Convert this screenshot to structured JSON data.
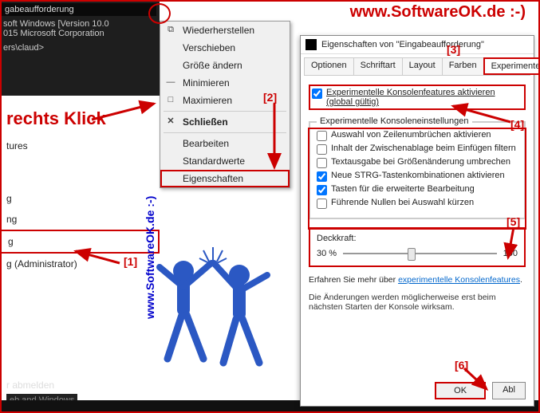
{
  "watermark_url": "www.SoftwareOK.de :-)",
  "annotation_rechts": "rechts Klick",
  "vertical_url": "www.SoftwareOK.de :-)",
  "console": {
    "title": "gabeaufforderung",
    "line1": "soft Windows [Version 10.0",
    "line2": "015 Microsoft Corporation",
    "prompt": "ers\\claud>"
  },
  "start_items": {
    "i0": "tures",
    "i1": "g",
    "i2": "ng",
    "i3": "g",
    "i4": "g (Administrator)",
    "logoff": "r abmelden",
    "bottom": "eb and Windows"
  },
  "ctx": {
    "restore": "Wiederherstellen",
    "move": "Verschieben",
    "size": "Größe ändern",
    "min": "Minimieren",
    "max": "Maximieren",
    "close": "Schließen",
    "edit": "Bearbeiten",
    "defaults": "Standardwerte",
    "props": "Eigenschaften"
  },
  "dialog": {
    "title": "Eigenschaften von \"Eingabeaufforderung\"",
    "tabs": {
      "options": "Optionen",
      "font": "Schriftart",
      "layout": "Layout",
      "colors": "Farben",
      "exp": "Experimentell"
    },
    "enable_exp": "Experimentelle Konsolenfeatures aktivieren (global gültig)",
    "group_label": "Experimentelle Konsoleneinstellungen",
    "opt1": "Auswahl von Zeilenumbrüchen aktivieren",
    "opt2": "Inhalt der Zwischenablage beim Einfügen filtern",
    "opt3": "Textausgabe bei Größenänderung umbrechen",
    "opt4": "Neue STRG-Tastenkombinationen aktivieren",
    "opt5": "Tasten für die erweiterte Bearbeitung",
    "opt6": "Führende Nullen bei Auswahl kürzen",
    "opacity_label": "Deckkraft:",
    "opacity_min": "30 %",
    "opacity_max": "100",
    "learn_pre": "Erfahren Sie mehr über ",
    "learn_link": "experimentelle Konsolenfeatures",
    "note": "Die Änderungen werden möglicherweise erst beim nächsten Starten der Konsole wirksam.",
    "ok": "OK",
    "cancel": "Abl"
  },
  "markers": {
    "m1": "[1]",
    "m2": "[2]",
    "m3": "[3]",
    "m4": "[4]",
    "m5": "[5]",
    "m6": "[6]"
  }
}
